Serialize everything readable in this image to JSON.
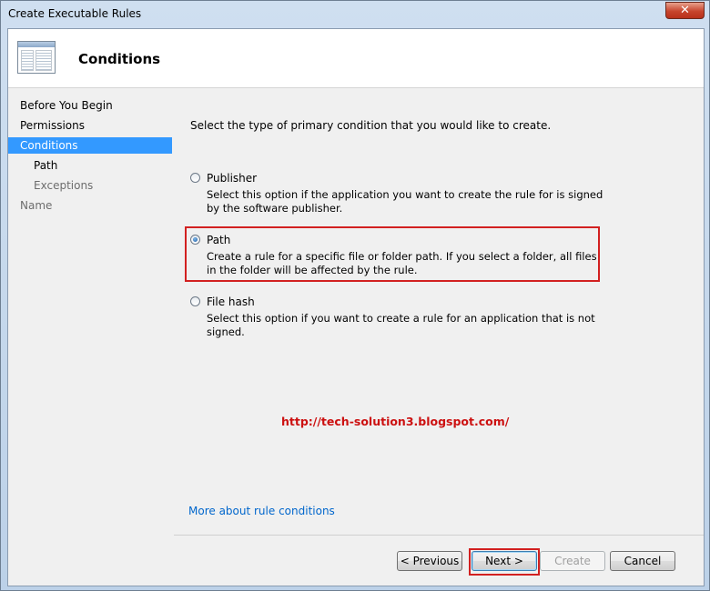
{
  "window": {
    "title": "Create Executable Rules",
    "close_label": "✕"
  },
  "header": {
    "title": "Conditions"
  },
  "nav": {
    "items": [
      {
        "label": "Before You Begin"
      },
      {
        "label": "Permissions"
      },
      {
        "label": "Conditions"
      },
      {
        "label": "Path"
      },
      {
        "label": "Exceptions"
      },
      {
        "label": "Name"
      }
    ]
  },
  "main": {
    "intro": "Select the type of primary condition that you would like to create.",
    "options": [
      {
        "label": "Publisher",
        "description": "Select this option if the application you want to create the rule for is signed by the software publisher.",
        "checked": false
      },
      {
        "label": "Path",
        "description": "Create a rule for a specific file or folder path. If you select a folder, all files in the folder will be affected by the rule.",
        "checked": true
      },
      {
        "label": "File hash",
        "description": "Select this option if you want to create a rule for an application that is not signed.",
        "checked": false
      }
    ],
    "watermark_url": "http://tech-solution3.blogspot.com/",
    "more_link": "More about rule conditions"
  },
  "footer": {
    "previous_label": "< Previous",
    "next_label": "Next >",
    "create_label": "Create",
    "cancel_label": "Cancel"
  }
}
